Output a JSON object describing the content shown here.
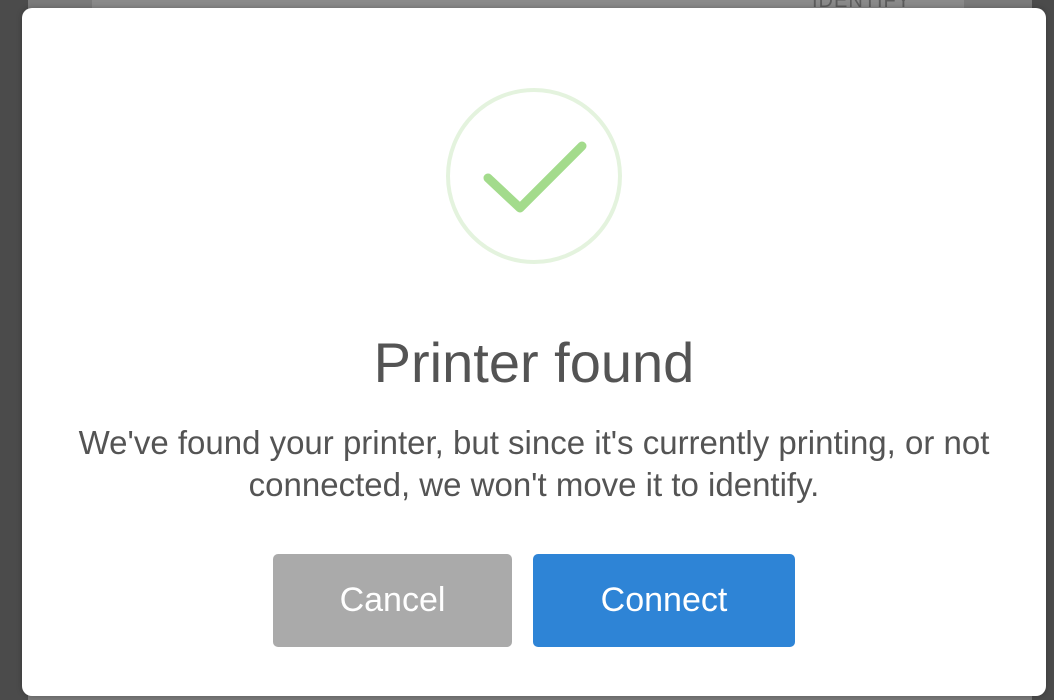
{
  "background": {
    "partial_text": "IDENTIFY"
  },
  "dialog": {
    "icon": "check-circle-icon",
    "icon_colors": {
      "ring": "#e4f3de",
      "check": "#a3db8c"
    },
    "title": "Printer found",
    "message": "We've found your printer, but since it's currently printing, or not connected, we won't move it to identify.",
    "buttons": {
      "cancel": "Cancel",
      "connect": "Connect"
    },
    "colors": {
      "cancel_bg": "#aaaaaa",
      "connect_bg": "#2e84d6",
      "text": "#545454"
    }
  }
}
